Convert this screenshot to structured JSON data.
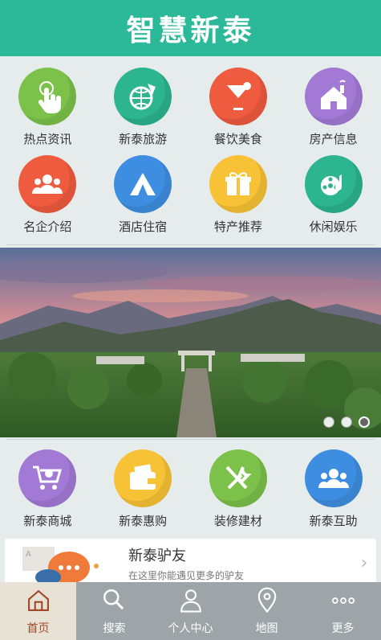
{
  "header": {
    "title": "智慧新泰"
  },
  "top_grid": [
    {
      "label": "热点资讯",
      "icon": "hand-pointer-icon",
      "color": "#7cc24a"
    },
    {
      "label": "新泰旅游",
      "icon": "globe-icon",
      "color": "#2cb58f"
    },
    {
      "label": "餐饮美食",
      "icon": "cocktail-icon",
      "color": "#ef5b3f"
    },
    {
      "label": "房产信息",
      "icon": "house-icon",
      "color": "#a27ad6"
    },
    {
      "label": "名企介绍",
      "icon": "group-icon",
      "color": "#ef5b3f"
    },
    {
      "label": "酒店住宿",
      "icon": "tent-icon",
      "color": "#3d8ee0"
    },
    {
      "label": "特产推荐",
      "icon": "gift-icon",
      "color": "#f7c236"
    },
    {
      "label": "休闲娱乐",
      "icon": "film-music-icon",
      "color": "#2cb58f"
    }
  ],
  "bottom_grid": [
    {
      "label": "新泰商城",
      "icon": "shopping-cart-icon",
      "color": "#a27ad6"
    },
    {
      "label": "新泰惠购",
      "icon": "wallet-icon",
      "color": "#f7c236"
    },
    {
      "label": "装修建材",
      "icon": "tools-icon",
      "color": "#7cc24a"
    },
    {
      "label": "新泰互助",
      "icon": "group-icon",
      "color": "#3d8ee0"
    }
  ],
  "banner": {
    "dots": 3,
    "active_dot": 2
  },
  "card": {
    "title": "新泰驴友",
    "subtitle": "在这里你能遇见更多的驴友"
  },
  "tabbar": [
    {
      "label": "首页",
      "icon": "home-icon",
      "active": true
    },
    {
      "label": "搜索",
      "icon": "search-icon",
      "active": false
    },
    {
      "label": "个人中心",
      "icon": "person-icon",
      "active": false
    },
    {
      "label": "地图",
      "icon": "map-pin-icon",
      "active": false
    },
    {
      "label": "更多",
      "icon": "more-icon",
      "active": false
    }
  ]
}
